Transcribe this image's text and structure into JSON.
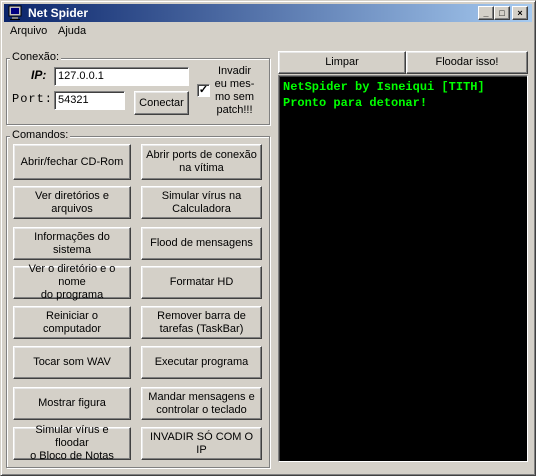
{
  "window": {
    "title": "Net Spider"
  },
  "title_buttons": {
    "minimize": "_",
    "maximize": "□",
    "close": "×"
  },
  "menu": [
    "Arquivo",
    "Ajuda"
  ],
  "connection": {
    "group_label": "Conexão:",
    "ip_label": "IP:",
    "ip_value": "127.0.0.1",
    "port_label": "Port:",
    "port_value": "54321",
    "connect_button": "Conectar",
    "checkbox_checked": true,
    "checkbox_mark": "✓",
    "checkbox_label": "Invadir eu mes-mo sem patch!!!"
  },
  "commands": {
    "group_label": "Comandos:",
    "buttons": [
      "Abrir/fechar CD-Rom",
      "Abrir ports de conexão\nna vítima",
      "Ver diretórios e arquivos",
      "Simular vírus na\nCalculadora",
      "Informações do sistema",
      "Flood de mensagens",
      "Ver o diretório e o nome\ndo programa",
      "Formatar HD",
      "Reiniciar o computador",
      "Remover barra de\ntarefas (TaskBar)",
      "Tocar som WAV",
      "Executar programa",
      "Mostrar figura",
      "Mandar mensagens e\ncontrolar o teclado",
      "Simular vírus e floodar\no Bloco de Notas",
      "INVADIR SÓ COM O IP"
    ]
  },
  "console": {
    "clear_button": "Limpar",
    "flood_button": "Floodar isso!",
    "lines": [
      "NetSpider by Isneiqui [TITH]",
      "Pronto para detonar!"
    ],
    "text_color": "#00ff00"
  }
}
